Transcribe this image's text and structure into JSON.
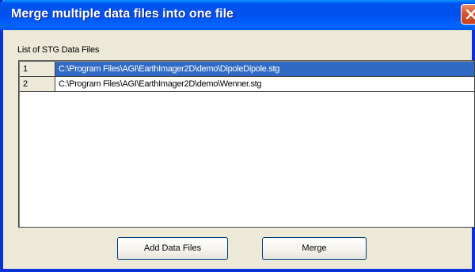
{
  "window": {
    "title": "Merge multiple data files into one file",
    "close_icon": "close-x-icon"
  },
  "list": {
    "label": "List of STG Data Files",
    "rows": [
      {
        "index": "1",
        "path": "C:\\Program Files\\AGI\\EarthImager2D\\demo\\DipoleDipole.stg",
        "selected": true
      },
      {
        "index": "2",
        "path": "C:\\Program Files\\AGI\\EarthImager2D\\demo\\Wenner.stg",
        "selected": false
      }
    ]
  },
  "buttons": {
    "add_label": "Add Data Files",
    "merge_label": "Merge"
  },
  "colors": {
    "titlebar": "#0050ee",
    "selection": "#316ac5",
    "close_button": "#d8552a",
    "dialog_background": "#ece9d8"
  }
}
